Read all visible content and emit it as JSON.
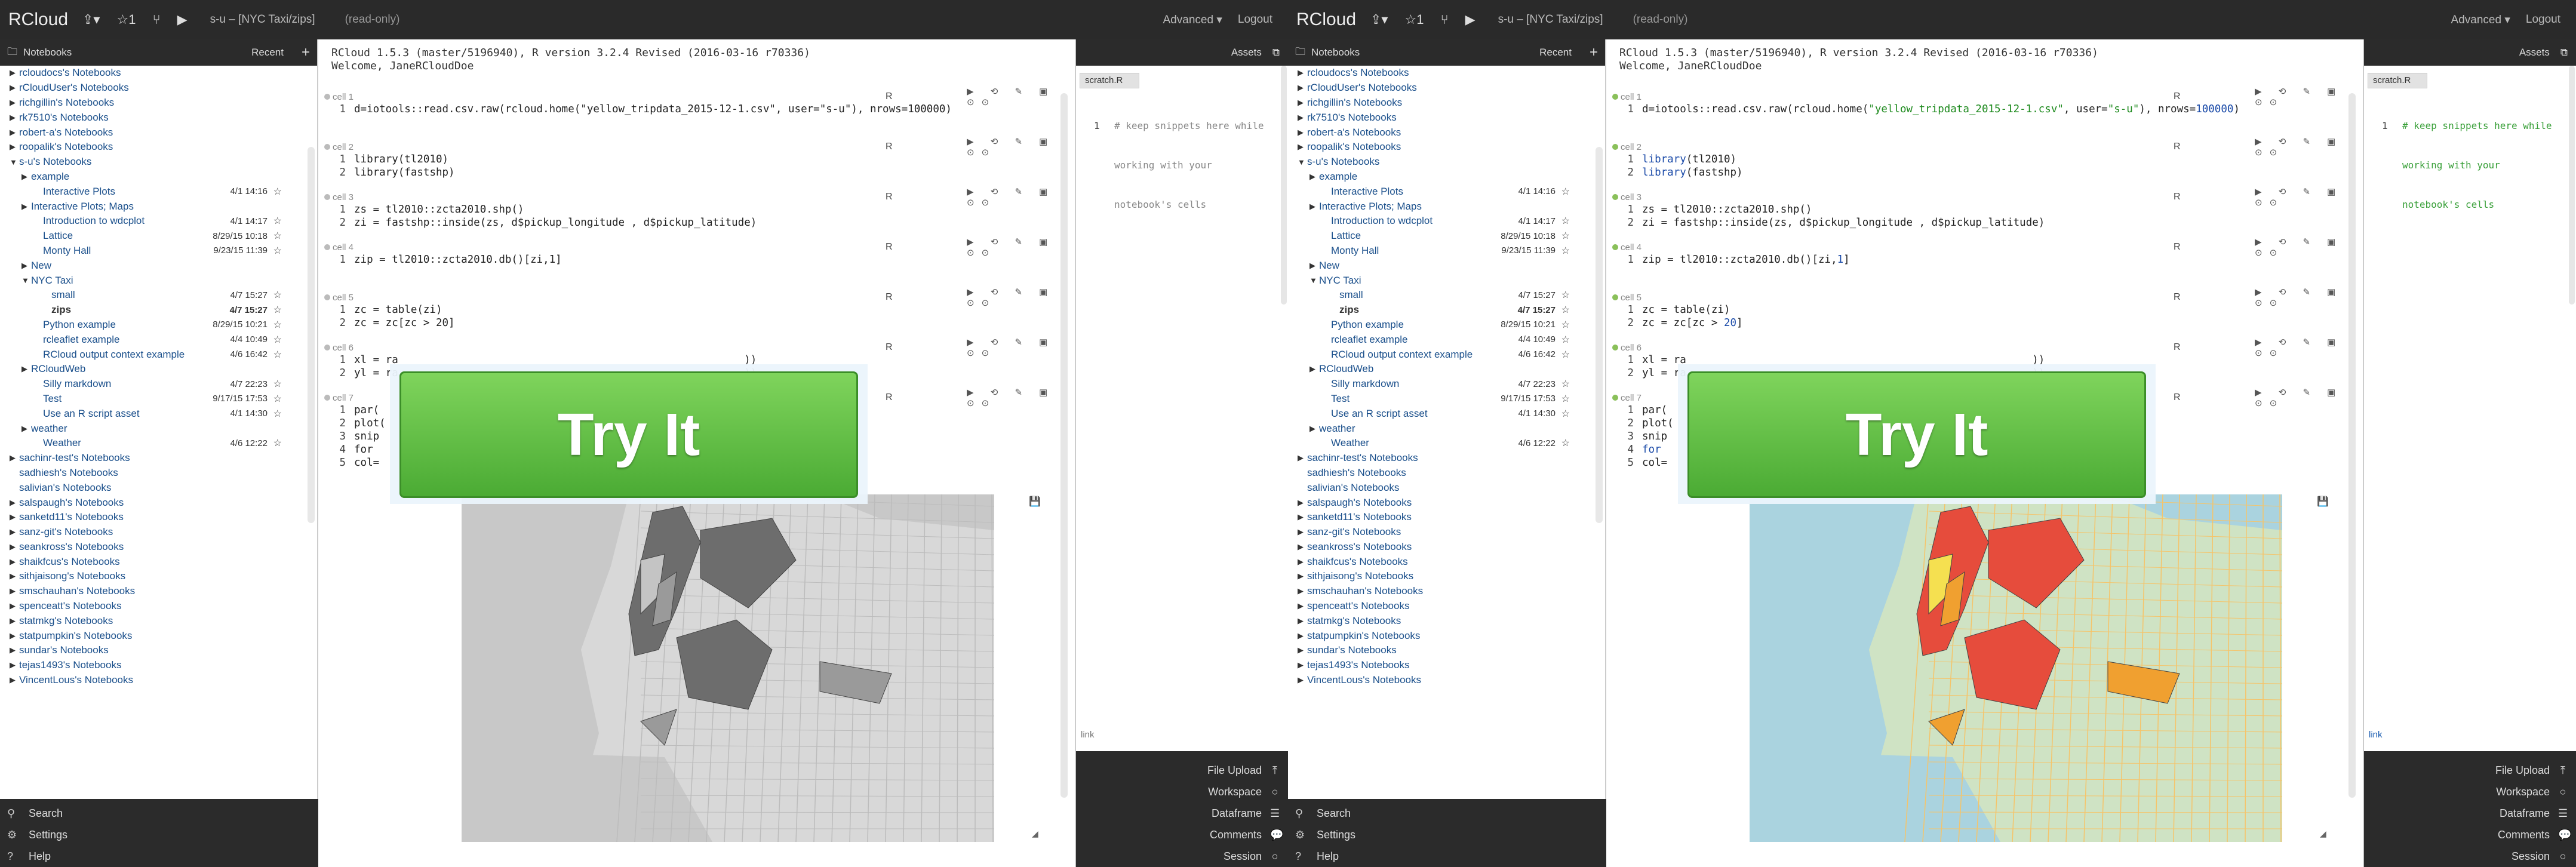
{
  "topbar": {
    "brand": "RCloud",
    "icons": [
      "share-icon",
      "star-icon",
      "fork-icon",
      "run-icon"
    ],
    "title": "s-u – [NYC Taxi/zips]",
    "readonly": "(read-only)",
    "advanced": "Advanced",
    "logout": "Logout"
  },
  "sidebar": {
    "header": "Notebooks",
    "recent": "Recent",
    "items": [
      {
        "label": "rcloudocs's Notebooks",
        "level": 0,
        "arrow": "▶"
      },
      {
        "label": "rCloudUser's Notebooks",
        "level": 0,
        "arrow": "▶"
      },
      {
        "label": "richgillin's Notebooks",
        "level": 0,
        "arrow": "▶"
      },
      {
        "label": "rk7510's Notebooks",
        "level": 0,
        "arrow": "▶"
      },
      {
        "label": "robert-a's Notebooks",
        "level": 0,
        "arrow": "▶"
      },
      {
        "label": "roopalik's Notebooks",
        "level": 0,
        "arrow": "▶"
      },
      {
        "label": "s-u's Notebooks",
        "level": 0,
        "arrow": "▼"
      },
      {
        "label": "example",
        "level": 1,
        "arrow": "▶"
      },
      {
        "label": "Interactive Plots",
        "level": 2,
        "arrow": "",
        "date": "4/1 14:16",
        "star": "☆"
      },
      {
        "label": "Interactive Plots; Maps",
        "level": 1,
        "arrow": "▶"
      },
      {
        "label": "Introduction to wdcplot",
        "level": 2,
        "arrow": "",
        "date": "4/1 14:17",
        "star": "☆"
      },
      {
        "label": "Lattice",
        "level": 2,
        "arrow": "",
        "date": "8/29/15 10:18",
        "star": "☆"
      },
      {
        "label": "Monty Hall",
        "level": 2,
        "arrow": "",
        "date": "9/23/15 11:39",
        "star": "☆"
      },
      {
        "label": "New",
        "level": 1,
        "arrow": "▶"
      },
      {
        "label": "NYC Taxi",
        "level": 1,
        "arrow": "▼"
      },
      {
        "label": "small",
        "level": 3,
        "arrow": "",
        "date": "4/7 15:27",
        "star": "☆"
      },
      {
        "label": "zips",
        "level": 3,
        "arrow": "",
        "date": "4/7 15:27",
        "star": "☆",
        "bold": true
      },
      {
        "label": "Python example",
        "level": 2,
        "arrow": "",
        "date": "8/29/15 10:21",
        "star": "☆"
      },
      {
        "label": "rcleaflet example",
        "level": 2,
        "arrow": "",
        "date": "4/4 10:49",
        "star": "☆"
      },
      {
        "label": "RCloud output context example",
        "level": 2,
        "arrow": "",
        "date": "4/6 16:42",
        "star": "☆"
      },
      {
        "label": "RCloudWeb",
        "level": 1,
        "arrow": "▶"
      },
      {
        "label": "Silly markdown",
        "level": 2,
        "arrow": "",
        "date": "4/7 22:23",
        "star": "☆"
      },
      {
        "label": "Test",
        "level": 2,
        "arrow": "",
        "date": "9/17/15 17:53",
        "star": "☆"
      },
      {
        "label": "Use an R script asset",
        "level": 2,
        "arrow": "",
        "date": "4/1 14:30",
        "star": "☆"
      },
      {
        "label": "weather",
        "level": 1,
        "arrow": "▶"
      },
      {
        "label": "Weather",
        "level": 2,
        "arrow": "",
        "date": "4/6 12:22",
        "star": "☆"
      },
      {
        "label": "sachinr-test's Notebooks",
        "level": 0,
        "arrow": "▶"
      },
      {
        "label": "sadhiesh's Notebooks",
        "level": 0,
        "arrow": ""
      },
      {
        "label": "salivian's Notebooks",
        "level": 0,
        "arrow": ""
      },
      {
        "label": "salspaugh's Notebooks",
        "level": 0,
        "arrow": "▶"
      },
      {
        "label": "sanketd11's Notebooks",
        "level": 0,
        "arrow": "▶"
      },
      {
        "label": "sanz-git's Notebooks",
        "level": 0,
        "arrow": "▶"
      },
      {
        "label": "seankross's Notebooks",
        "level": 0,
        "arrow": "▶"
      },
      {
        "label": "shaikfcus's Notebooks",
        "level": 0,
        "arrow": "▶"
      },
      {
        "label": "sithjaisong's Notebooks",
        "level": 0,
        "arrow": "▶"
      },
      {
        "label": "smschauhan's Notebooks",
        "level": 0,
        "arrow": "▶"
      },
      {
        "label": "spenceatt's Notebooks",
        "level": 0,
        "arrow": "▶"
      },
      {
        "label": "statmkg's Notebooks",
        "level": 0,
        "arrow": "▶"
      },
      {
        "label": "statpumpkin's Notebooks",
        "level": 0,
        "arrow": "▶"
      },
      {
        "label": "sundar's Notebooks",
        "level": 0,
        "arrow": "▶"
      },
      {
        "label": "tejas1493's Notebooks",
        "level": 0,
        "arrow": "▶"
      },
      {
        "label": "VincentLous's Notebooks",
        "level": 0,
        "arrow": "▶"
      }
    ],
    "footer": [
      {
        "label": "Search",
        "icon": "search-icon"
      },
      {
        "label": "Settings",
        "icon": "gear-icon"
      },
      {
        "label": "Help",
        "icon": "help-icon"
      }
    ]
  },
  "notebook": {
    "header_line1": "RCloud 1.5.3 (master/5196940), R version 3.2.4 Revised (2016-03-16 r70336)",
    "header_line2": "Welcome, JaneRCloudDoe",
    "cells": [
      {
        "title": "cell 1",
        "lang": "R",
        "lines": [
          [
            {
              "t": "d=iotools::read.csv.raw(rcloud.home(",
              "c": ""
            },
            {
              "t": "\"yellow_tripdata_2015-12-1.csv\"",
              "c": "str"
            },
            {
              "t": ", user=",
              "c": ""
            },
            {
              "t": "\"s-u\"",
              "c": "str"
            },
            {
              "t": "), nrows=",
              "c": ""
            },
            {
              "t": "100000",
              "c": "num"
            },
            {
              "t": ")",
              "c": ""
            }
          ]
        ]
      },
      {
        "title": "cell 2",
        "lang": "R",
        "lines": [
          [
            {
              "t": "library",
              "c": "kw"
            },
            {
              "t": "(tl2010)",
              "c": ""
            }
          ],
          [
            {
              "t": "library",
              "c": "kw"
            },
            {
              "t": "(fastshp)",
              "c": ""
            }
          ]
        ]
      },
      {
        "title": "cell 3",
        "lang": "R",
        "lines": [
          [
            {
              "t": "zs = tl2010::zcta2010.shp()",
              "c": ""
            }
          ],
          [
            {
              "t": "zi = fastshp::inside(zs, d$pickup_longitude , d$pickup_latitude)",
              "c": ""
            }
          ]
        ]
      },
      {
        "title": "cell 4",
        "lang": "R",
        "lines": [
          [
            {
              "t": "zip = tl2010::zcta2010.db()[zi,",
              "c": ""
            },
            {
              "t": "1",
              "c": "num"
            },
            {
              "t": "]",
              "c": ""
            }
          ]
        ]
      },
      {
        "title": "cell 5",
        "lang": "R",
        "lines": [
          [
            {
              "t": "zc = table(zi)",
              "c": ""
            }
          ],
          [
            {
              "t": "zc = zc[zc > ",
              "c": ""
            },
            {
              "t": "20",
              "c": "num"
            },
            {
              "t": "]",
              "c": ""
            }
          ]
        ]
      },
      {
        "title": "cell 6",
        "lang": "R",
        "lines": [
          [
            {
              "t": "xl = ",
              "c": ""
            },
            {
              "t": "ra",
              "c": ""
            },
            {
              "t": "                                                       ))",
              "c": ""
            }
          ],
          [
            {
              "t": "yl = ",
              "c": ""
            },
            {
              "t": "ra",
              "c": ""
            },
            {
              "t": "                                                       ))",
              "c": ""
            }
          ]
        ]
      },
      {
        "title": "cell 7",
        "lang": "R",
        "lines": [
          [
            {
              "t": "par(",
              "c": ""
            }
          ],
          [
            {
              "t": "plot(",
              "c": ""
            }
          ],
          [
            {
              "t": "snip",
              "c": ""
            }
          ],
          [
            {
              "t": "for ",
              "c": "kw"
            },
            {
              "t": "                                                        40\",",
              "c": ""
            }
          ],
          [
            {
              "t": "col=",
              "c": ""
            }
          ]
        ]
      }
    ],
    "overlay_button": "Try It"
  },
  "rightpanel": {
    "header": "Assets",
    "tab": "scratch.R",
    "code_lines": [
      "# keep snippets here while",
      "working with your",
      "notebook's cells"
    ],
    "link": "link",
    "footer": [
      {
        "label": "File Upload",
        "icon": "upload-icon"
      },
      {
        "label": "Workspace",
        "icon": "circle-icon"
      },
      {
        "label": "Dataframe",
        "icon": "table-icon"
      },
      {
        "label": "Comments",
        "icon": "comment-icon"
      },
      {
        "label": "Session",
        "icon": "circle-icon"
      }
    ]
  },
  "colors": {
    "chrome": "#2b2b2b",
    "link_blue": "#1a4f8b",
    "try_it_green": "#5cbf3e",
    "map_zip_red": "#e64c3c",
    "map_zip_orange": "#f0a030",
    "map_zip_yellow": "#f5e050",
    "map_gray": "#555555"
  }
}
